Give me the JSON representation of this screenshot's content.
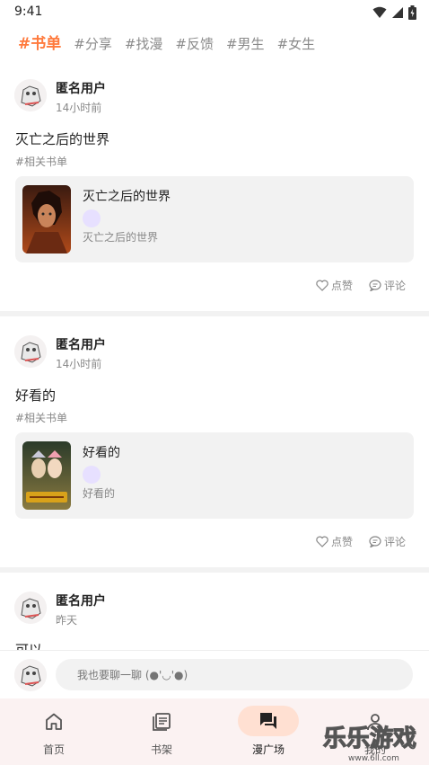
{
  "status": {
    "time": "9:41"
  },
  "tabs": [
    "#书单",
    "#分享",
    "#找漫",
    "#反馈",
    "#男生",
    "#女生"
  ],
  "posts": [
    {
      "username": "匿名用户",
      "time": "14小时前",
      "title": "灭亡之后的世界",
      "tag": "#相关书单",
      "card": {
        "title": "灭亡之后的世界",
        "subtitle": "灭亡之后的世界"
      },
      "like_label": "点赞",
      "comment_label": "评论"
    },
    {
      "username": "匿名用户",
      "time": "14小时前",
      "title": "好看的",
      "tag": "#相关书单",
      "card": {
        "title": "好看的",
        "subtitle": "好看的"
      },
      "like_label": "点赞",
      "comment_label": "评论"
    },
    {
      "username": "匿名用户",
      "time": "昨天",
      "title": "可以"
    }
  ],
  "comment_bar": {
    "placeholder": "我也要聊一聊 (●'◡'●)"
  },
  "nav": [
    {
      "label": "首页",
      "icon": "home-icon"
    },
    {
      "label": "书架",
      "icon": "bookshelf-icon"
    },
    {
      "label": "漫广场",
      "icon": "chat-icon"
    },
    {
      "label": "我的",
      "icon": "profile-icon"
    }
  ],
  "watermark": {
    "text": "乐乐游戏",
    "url": "www.6ll.com"
  },
  "colors": {
    "accent": "#ff7a3d",
    "pill": "#ffe0d2",
    "card_bg": "#f2f2f2",
    "nav_bg": "#fbf2f2"
  }
}
